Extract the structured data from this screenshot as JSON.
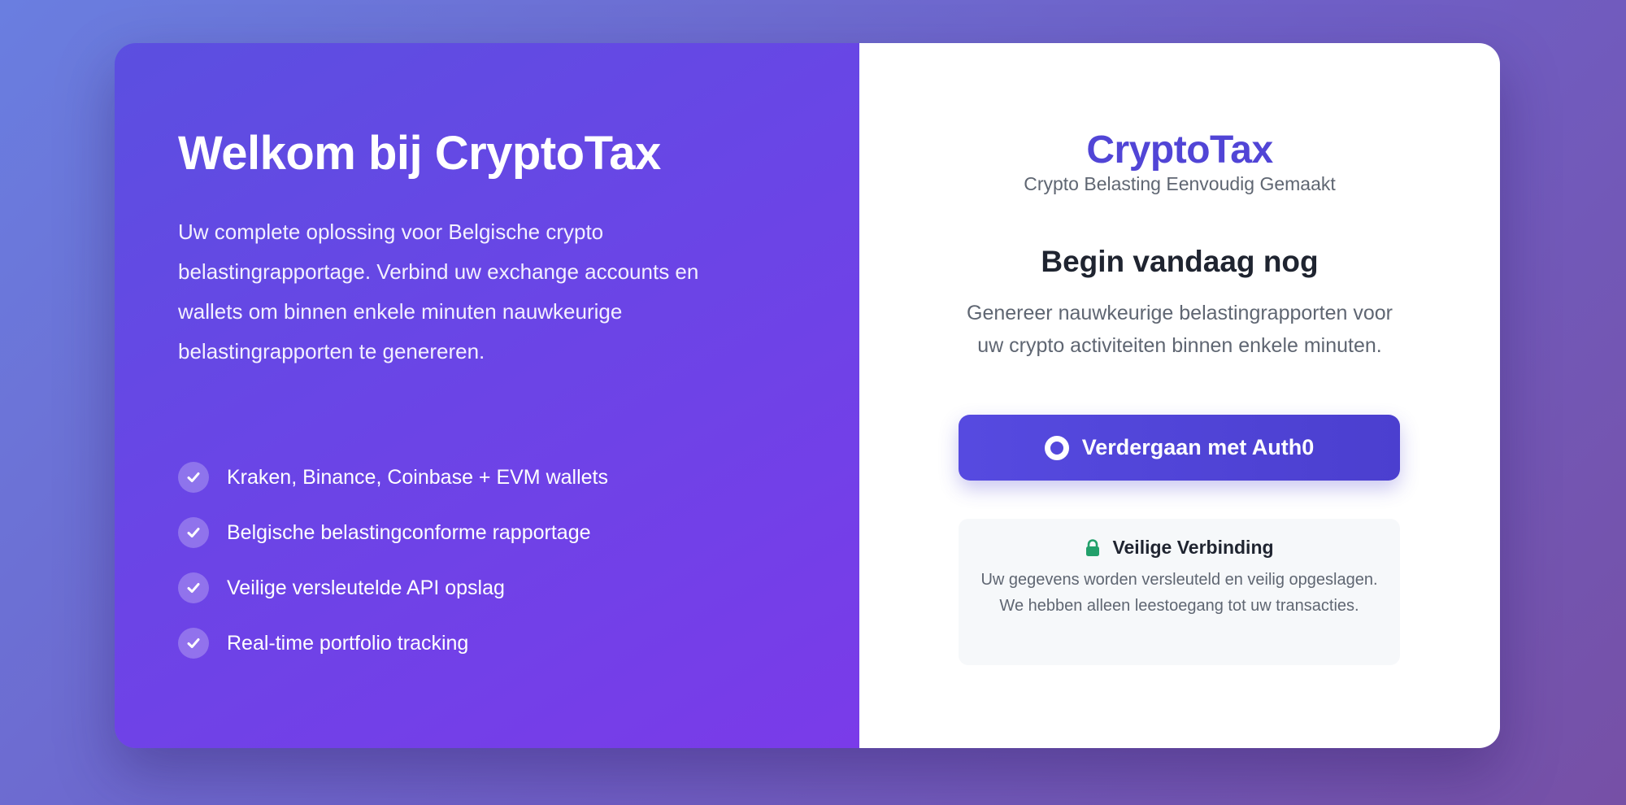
{
  "left_panel": {
    "title": "Welkom bij CryptoTax",
    "intro": "Uw complete oplossing voor Belgische crypto belastingrapportage. Verbind uw exchange accounts en wallets om binnen enkele minuten nauwkeurige belastingrapporten te genereren.",
    "features": [
      {
        "label": "Kraken, Binance, Coinbase + EVM wallets",
        "icon": "check-icon"
      },
      {
        "label": "Belgische belastingconforme rapportage",
        "icon": "check-icon"
      },
      {
        "label": "Veilige versleutelde API opslag",
        "icon": "check-icon"
      },
      {
        "label": "Real-time portfolio tracking",
        "icon": "check-icon"
      }
    ]
  },
  "right_panel": {
    "brand": "CryptoTax",
    "tagline": "Crypto Belasting Eenvoudig Gemaakt",
    "headline": "Begin vandaag nog",
    "description": "Genereer nauwkeurige belastingrapporten voor uw crypto activiteiten binnen enkele minuten.",
    "auth_button": {
      "label": "Verdergaan met Auth0",
      "icon": "auth0-ring-icon"
    },
    "secure": {
      "icon": "lock-icon",
      "title": "Veilige Verbinding",
      "text": "Uw gegevens worden versleuteld en veilig opgeslagen. We hebben alleen leestoegang tot uw transacties."
    }
  },
  "colors": {
    "accent": "#5145d6",
    "button": "#564ae0",
    "secure_green": "#22a06b",
    "left_panel_start": "#5b4fe0",
    "left_panel_end": "#7a3be9"
  }
}
